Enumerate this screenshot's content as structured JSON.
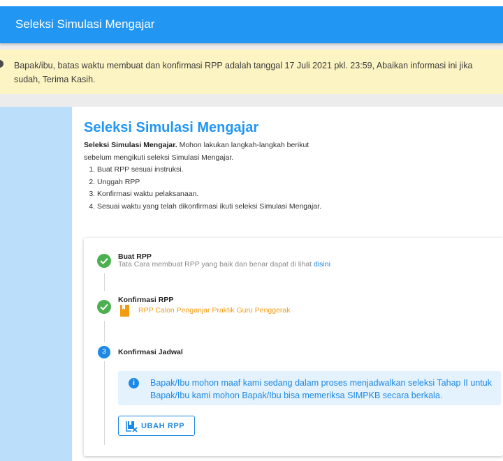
{
  "appbar": {
    "title": "Seleksi Simulasi Mengajar"
  },
  "alert": {
    "text": "Bapak/ibu, batas waktu membuat dan konfirmasi RPP adalah tanggal 17 Juli 2021 pkl. 23:59, Abaikan informasi ini jika sudah, Terima Kasih."
  },
  "main": {
    "title": "Seleksi Simulasi Mengajar",
    "intro_bold": "Seleksi Simulasi Mengajar.",
    "intro_rest": " Mohon lakukan langkah-langkah berikut sebelum mengikuti seleksi Simulasi Mengajar.",
    "instructions": [
      "Buat RPP sesuai instruksi.",
      "Unggah RPP",
      "Konfirmasi waktu pelaksanaan.",
      "Sesuai waktu yang telah dikonfirmasi ikuti seleksi Simulasi Mengajar."
    ]
  },
  "steps": {
    "step1": {
      "title": "Buat RPP",
      "subtitle": "Tata Cara membuat RPP yang baik dan benar dapat di lihat ",
      "link": "disini",
      "status_icon": "check-icon"
    },
    "step2": {
      "title": "Konfirmasi RPP",
      "document": "RPP Calon Penganjar Praktik Guru Penggerak",
      "status_icon": "check-icon"
    },
    "step3": {
      "number": "3",
      "title": "Konfirmasi Jadwal",
      "info": "Bapak/Ibu mohon maaf kami sedang dalam proses menjadwalkan seleksi Tahap II untuk Bapak/Ibu kami mohon Bapak/Ibu bisa memeriksa SIMPKB secara berkala.",
      "button_label": "UBAH RPP"
    }
  },
  "colors": {
    "primary": "#2196f3",
    "success": "#4caf50",
    "warning_bg": "#fdf4c3",
    "sidebar": "#bbdefb",
    "document": "#f39c12"
  }
}
